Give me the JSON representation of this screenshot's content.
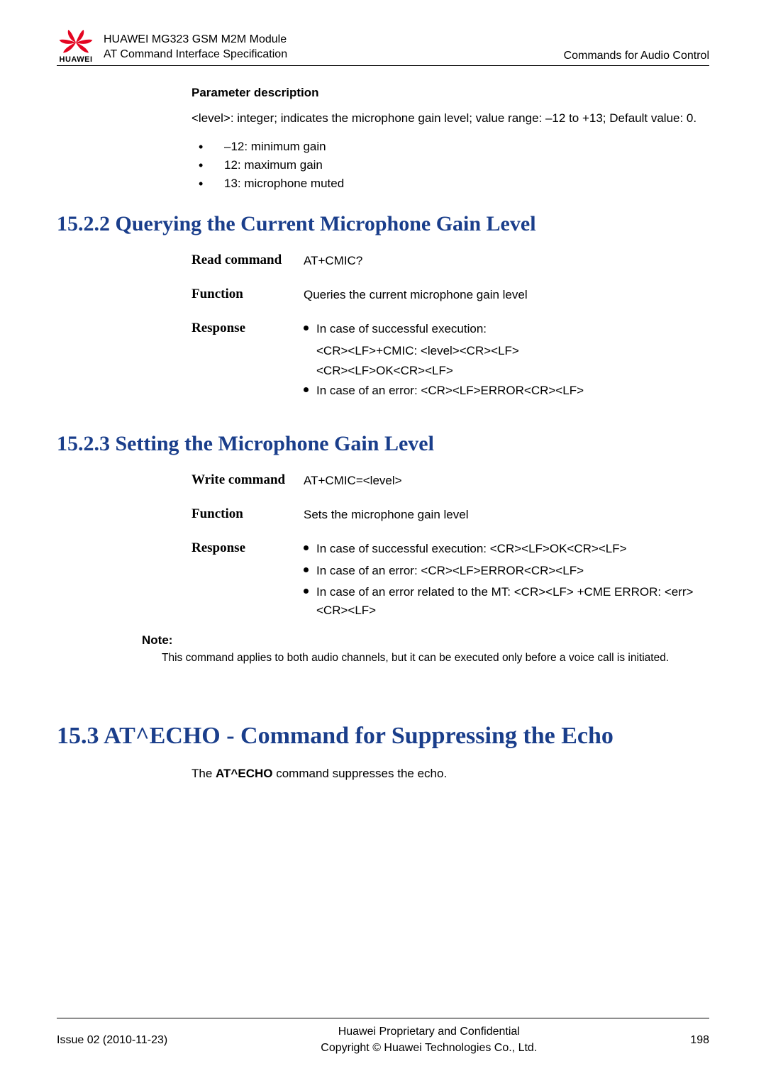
{
  "header": {
    "brand": "HUAWEI",
    "line1": "HUAWEI MG323 GSM M2M Module",
    "line2": "AT Command Interface Specification",
    "right": "Commands for Audio Control"
  },
  "param": {
    "heading": "Parameter description",
    "text": "<level>: integer; indicates the microphone gain level; value range: –12 to +13; Default value: 0.",
    "bullets": [
      "–12: minimum gain",
      "12: maximum gain",
      "13: microphone muted"
    ]
  },
  "sec1522": {
    "title": "15.2.2 Querying the Current Microphone Gain Level",
    "rows": {
      "read_label": "Read command",
      "read_value": "AT+CMIC?",
      "func_label": "Function",
      "func_value": "Queries the current microphone gain level",
      "resp_label": "Response",
      "resp_dot1": "In case of successful execution:",
      "resp_sub1": "<CR><LF>+CMIC: <level><CR><LF>",
      "resp_sub2": "<CR><LF>OK<CR><LF>",
      "resp_dot2": "In case of an error: <CR><LF>ERROR<CR><LF>"
    }
  },
  "sec1523": {
    "title": "15.2.3 Setting the Microphone Gain Level",
    "rows": {
      "write_label": "Write command",
      "write_value": "AT+CMIC=<level>",
      "func_label": "Function",
      "func_value": "Sets the microphone gain level",
      "resp_label": "Response",
      "resp_dot1": "In case of successful execution: <CR><LF>OK<CR><LF>",
      "resp_dot2": "In case of an error: <CR><LF>ERROR<CR><LF>",
      "resp_dot3": "In case of an error related to the MT: <CR><LF> +CME ERROR: <err><CR><LF>"
    },
    "note_label": "Note:",
    "note_text": "This command applies to both audio channels, but it can be executed only before a voice call is initiated."
  },
  "sec153": {
    "title": "15.3 AT^ECHO - Command for Suppressing the Echo",
    "text_pre": "The ",
    "text_bold": "AT^ECHO",
    "text_post": " command suppresses the echo."
  },
  "footer": {
    "left": "Issue 02 (2010-11-23)",
    "center1": "Huawei Proprietary and Confidential",
    "center2": "Copyright © Huawei Technologies Co., Ltd.",
    "right": "198"
  }
}
